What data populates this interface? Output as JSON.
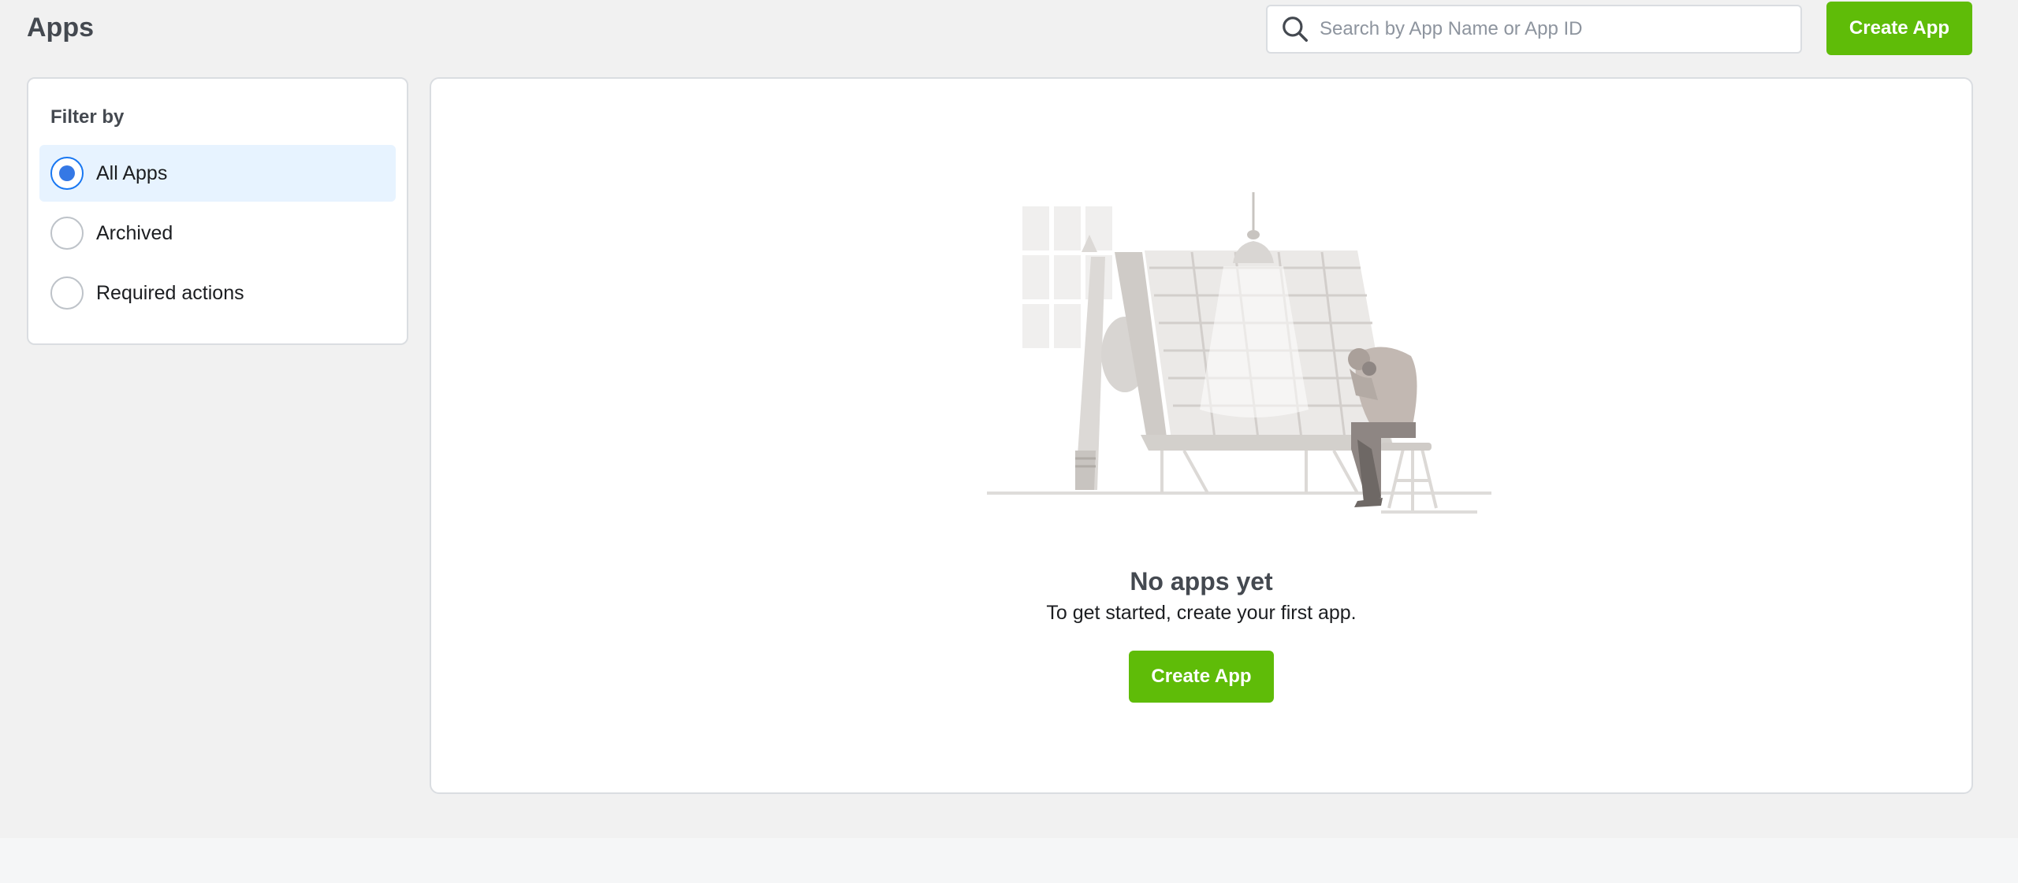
{
  "header": {
    "title": "Apps",
    "search_placeholder": "Search by App Name or App ID",
    "search_value": "",
    "create_button": "Create App"
  },
  "filter": {
    "title": "Filter by",
    "options": [
      {
        "label": "All Apps",
        "selected": true
      },
      {
        "label": "Archived",
        "selected": false
      },
      {
        "label": "Required actions",
        "selected": false
      }
    ]
  },
  "empty_state": {
    "title": "No apps yet",
    "subtitle": "To get started, create your first app.",
    "create_button": "Create App"
  },
  "colors": {
    "brand_green": "#5fbc08",
    "selected_bg": "#e7f3ff",
    "radio_accent": "#1877f2",
    "page_bg": "#f1f1f1"
  },
  "icons": {
    "search": "search-icon",
    "illustration": "empty-apps-illustration"
  }
}
